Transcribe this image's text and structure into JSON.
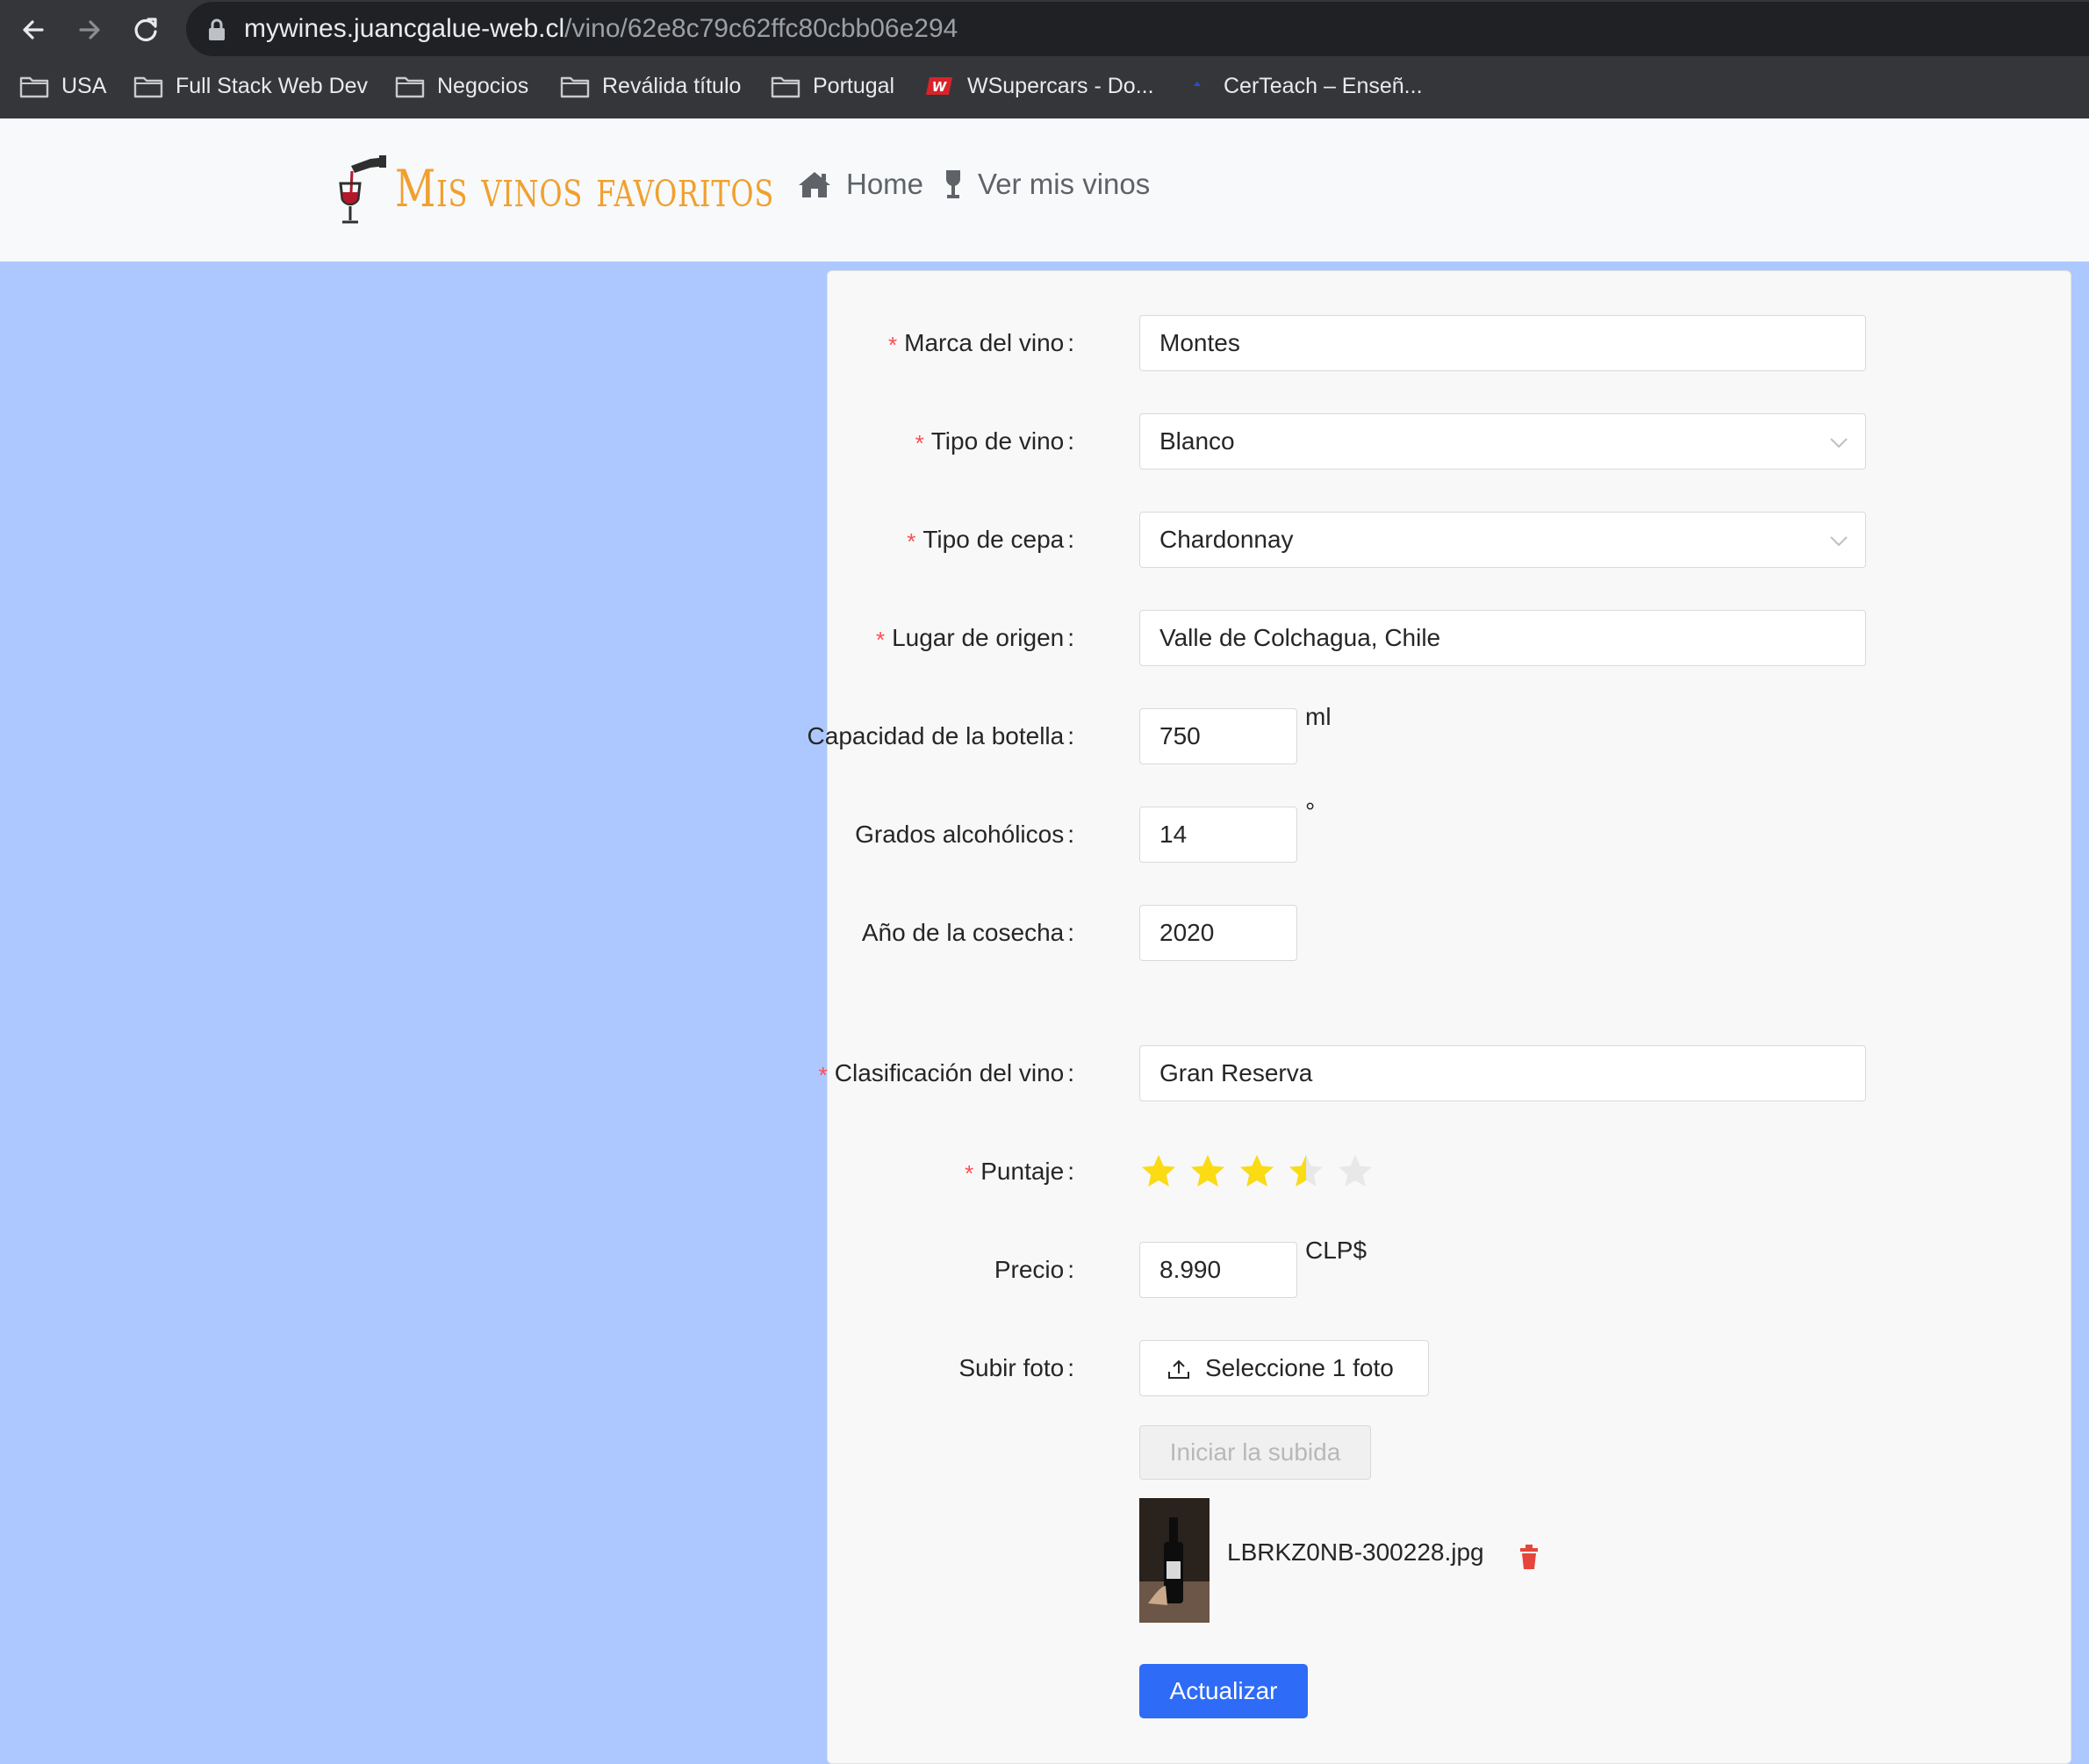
{
  "browser": {
    "url_host": "mywines.juancgalue-web.cl",
    "url_path": "/vino/62e8c79c62ffc80cbb06e294",
    "bookmarks": [
      {
        "label": "USA",
        "icon": "folder-icon"
      },
      {
        "label": "Full Stack Web Dev",
        "icon": "folder-icon"
      },
      {
        "label": "Negocios",
        "icon": "folder-icon"
      },
      {
        "label": "Reválida título",
        "icon": "folder-icon"
      },
      {
        "label": "Portugal",
        "icon": "folder-icon"
      },
      {
        "label": "WSupercars - Do...",
        "icon": "wsupercars-favicon"
      },
      {
        "label": "CerTeach – Enseñ...",
        "icon": "certeach-favicon"
      }
    ]
  },
  "header": {
    "logo_text": "Mis vinos favoritos",
    "nav": [
      {
        "label": "Home",
        "icon": "home-icon"
      },
      {
        "label": "Ver mis vinos",
        "icon": "wine-glass-icon"
      }
    ]
  },
  "form": {
    "brand": {
      "label": "Marca del vino",
      "value": "Montes",
      "required": true
    },
    "wine_type": {
      "label": "Tipo de vino",
      "value": "Blanco",
      "required": true
    },
    "grape": {
      "label": "Tipo de cepa",
      "value": "Chardonnay",
      "required": true
    },
    "origin": {
      "label": "Lugar de origen",
      "value": "Valle de Colchagua, Chile",
      "required": true
    },
    "capacity": {
      "label": "Capacidad de la botella",
      "value": "750",
      "suffix": "ml",
      "required": false
    },
    "alcohol": {
      "label": "Grados alcohólicos",
      "value": "14",
      "suffix": "°",
      "required": false
    },
    "vintage": {
      "label": "Año de la cosecha",
      "value": "2020",
      "required": false
    },
    "classification": {
      "label": "Clasificación del vino",
      "value": "Gran Reserva",
      "required": true
    },
    "rating": {
      "label": "Puntaje",
      "value": 3.5,
      "max": 5,
      "required": true
    },
    "price": {
      "label": "Precio",
      "value": "8.990",
      "suffix": "CLP$",
      "required": false
    },
    "photo": {
      "label": "Subir foto",
      "select_button": "Seleccione 1 foto",
      "start_upload_button": "Iniciar la subida",
      "file_name": "LBRKZ0NB-300228.jpg"
    },
    "submit_label": "Actualizar"
  },
  "colors": {
    "page_background": "#acc8ff",
    "logo": "#f0a030",
    "primary_button": "#2e6bf6",
    "required_mark": "#ff4d4f",
    "star_filled": "#fadb14",
    "star_empty": "#e8e8e8",
    "delete_icon": "#e5453b"
  }
}
